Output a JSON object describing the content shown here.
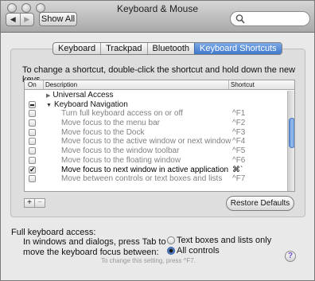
{
  "window": {
    "title": "Keyboard & Mouse"
  },
  "toolbar": {
    "back_label": "◀",
    "forward_label": "▶",
    "show_all_label": "Show All",
    "search": {
      "placeholder": "",
      "value": ""
    }
  },
  "tabs": [
    {
      "label": "Keyboard",
      "active": false
    },
    {
      "label": "Trackpad",
      "active": false
    },
    {
      "label": "Bluetooth",
      "active": false
    },
    {
      "label": "Keyboard Shortcuts",
      "active": true
    }
  ],
  "instruction": "To change a shortcut, double-click the shortcut and hold down the new keys.",
  "table": {
    "columns": {
      "on": "On",
      "description": "Description",
      "shortcut": "Shortcut"
    },
    "rows": [
      {
        "type": "group",
        "expanded": false,
        "checked": "none",
        "description": "Universal Access",
        "shortcut": ""
      },
      {
        "type": "group",
        "expanded": true,
        "checked": "mixed",
        "description": "Keyboard Navigation",
        "shortcut": ""
      },
      {
        "type": "child",
        "checked": "no",
        "description": "Turn full keyboard access on or off",
        "shortcut": "^F1"
      },
      {
        "type": "child",
        "checked": "no",
        "description": "Move focus to the menu bar",
        "shortcut": "^F2"
      },
      {
        "type": "child",
        "checked": "no",
        "description": "Move focus to the Dock",
        "shortcut": "^F3"
      },
      {
        "type": "child",
        "checked": "no",
        "description": "Move focus to the active window or next window",
        "shortcut": "^F4"
      },
      {
        "type": "child",
        "checked": "no",
        "description": "Move focus to the window toolbar",
        "shortcut": "^F5"
      },
      {
        "type": "child",
        "checked": "no",
        "description": "Move focus to the floating window",
        "shortcut": "^F6"
      },
      {
        "type": "child",
        "checked": "yes",
        "description": "Move focus to next window in active application",
        "shortcut": "⌘`"
      },
      {
        "type": "child",
        "checked": "no",
        "description": "Move between controls or text boxes and lists",
        "shortcut": "^F7"
      }
    ]
  },
  "buttons": {
    "plus": "+",
    "minus": "−",
    "restore_defaults": "Restore Defaults"
  },
  "full_keyboard_access": {
    "label": "Full keyboard access:",
    "desc_line1": "In windows and dialogs, press Tab to",
    "desc_line2": "move the keyboard focus between:",
    "options": [
      {
        "label": "Text boxes and lists only",
        "selected": false
      },
      {
        "label": "All controls",
        "selected": true
      }
    ],
    "hint": "To change this setting, press ^F7."
  },
  "help_label": "?"
}
